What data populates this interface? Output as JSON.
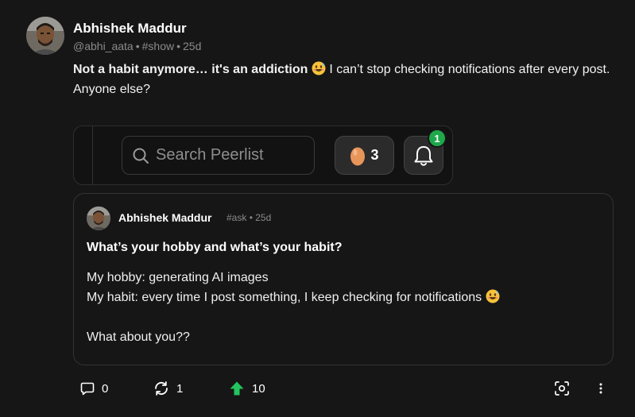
{
  "author": {
    "name": "Abhishek Maddur",
    "handle": "@abhi_aata",
    "channel": "#show",
    "age": "25d"
  },
  "post": {
    "lead": "Not a habit anymore… it's an addiction",
    "rest": "I can’t stop checking notifications after every post.",
    "line2": "Anyone else?"
  },
  "embedded_image": {
    "search_placeholder": "Search Peerlist",
    "eggs_count": "3",
    "notification_badge": "1"
  },
  "quoted_post": {
    "author": "Abhishek Maddur",
    "channel": "#ask",
    "age": "25d",
    "title": "What’s your hobby and what’s your habit?",
    "line1": "My hobby: generating AI images",
    "line2": "My habit: every time I post something, I keep checking for notifications",
    "line3": "What about you??"
  },
  "actions": {
    "comments": "0",
    "reposts": "1",
    "upvotes": "10"
  },
  "colors": {
    "background": "#161616",
    "upvote": "#22c55e",
    "badge": "#1ea84a",
    "muted": "#8a8a8a"
  },
  "icons": [
    "comment-icon",
    "repost-icon",
    "upvote-arrow-icon",
    "screenshot-icon",
    "more-icon",
    "search-icon",
    "egg-icon",
    "bell-icon",
    "smiling-face-emoji"
  ]
}
